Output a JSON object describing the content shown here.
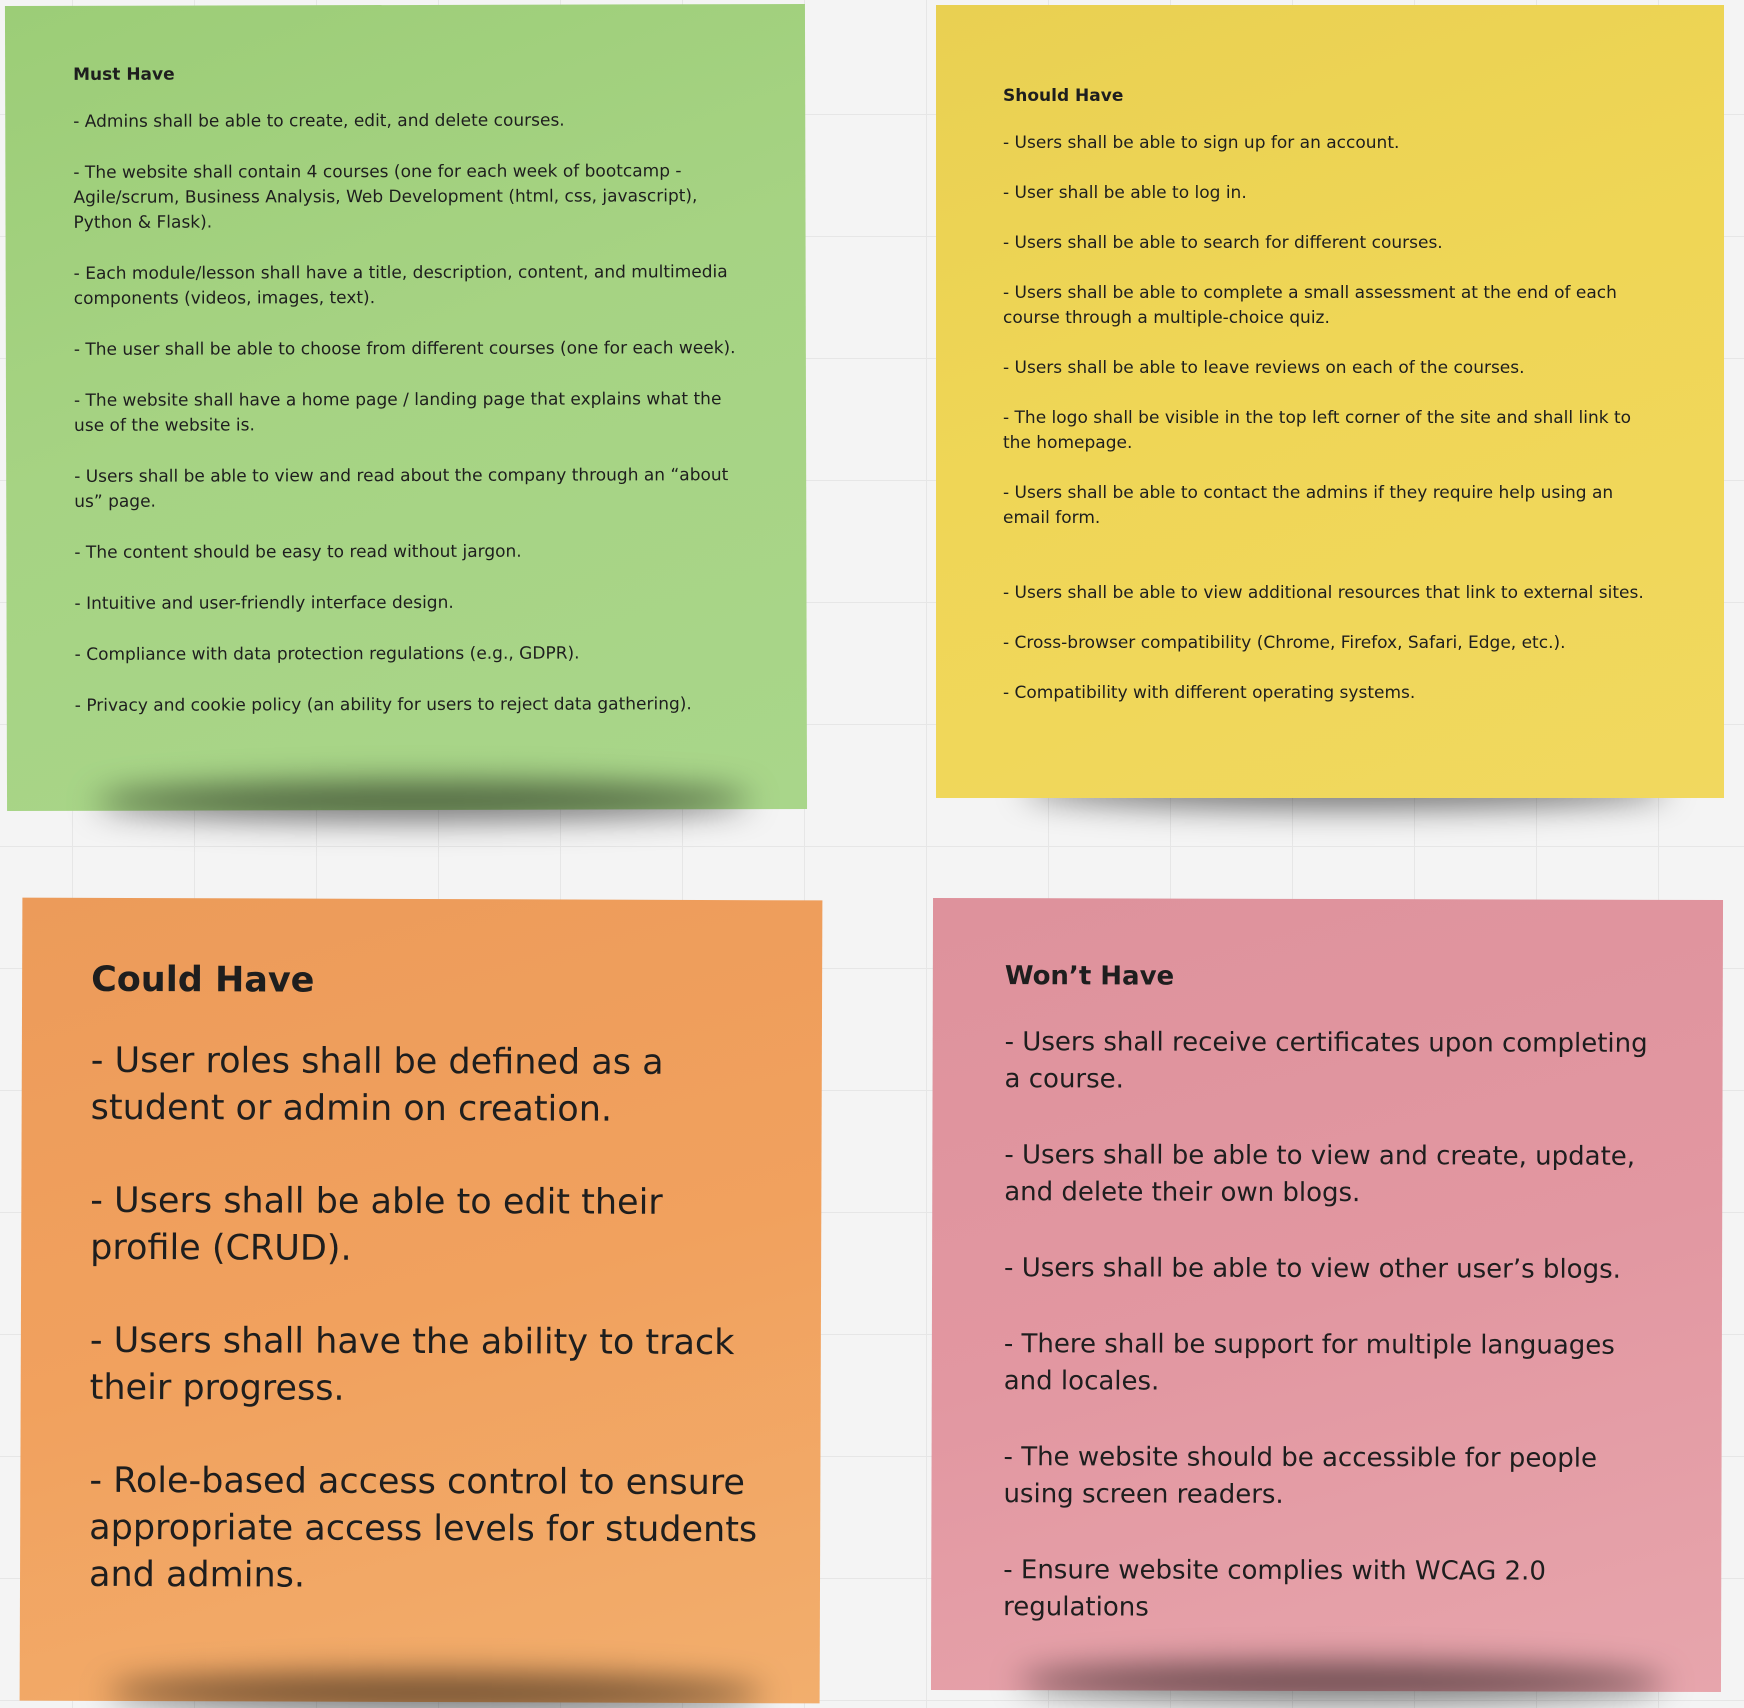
{
  "notes": {
    "must": {
      "title": "Must Have",
      "color": "#a6d383",
      "items": [
        "- Admins shall be able to create, edit, and delete courses.",
        "- The website shall contain 4 courses (one for each week of bootcamp - Agile/scrum, Business Analysis, Web Development (html, css, javascript), Python & Flask).",
        "- Each module/lesson shall have a title, description, content, and multimedia components (videos, images, text).",
        "- The user shall be able to choose from different courses (one for each week).",
        "- The website shall have a home page / landing page that explains what the use of the website is.",
        "- Users shall be able to view and read about the company through an “about us” page.",
        "- The content should be easy to read without jargon.",
        "- Intuitive and user-friendly interface design.",
        "- Compliance with data protection regulations (e.g., GDPR).",
        "- Privacy and cookie policy (an ability for users to reject data gathering)."
      ]
    },
    "should": {
      "title": "Should Have",
      "color": "#efd656",
      "items": [
        "- Users shall be able to sign up for an account.",
        "- User shall be able to log in.",
        "- Users shall be able to search for different courses.",
        "- Users shall be able to complete a small assessment at the end of each course through a multiple-choice quiz.",
        "- Users shall be able to leave reviews on each of the courses.",
        "- The logo shall be visible in the top left corner of the site and shall link to the homepage.",
        "- Users shall be able to contact the admins if they require help using an email form.",
        "- Users shall be able to view additional resources that link to external sites.",
        "- Cross-browser compatibility (Chrome, Firefox, Safari, Edge, etc.).",
        "- Compatibility with different operating systems."
      ]
    },
    "could": {
      "title": "Could Have",
      "color": "#f1a15e",
      "items": [
        "- User roles shall be defined as a student or admin on creation.",
        "- Users shall be able to edit their profile (CRUD).",
        "- Users shall have the ability to track their progress.",
        "- Role-based access control to ensure appropriate access levels for students and admins."
      ]
    },
    "wont": {
      "title": "Won’t Have",
      "color": "#e297a1",
      "items": [
        "- Users shall receive certificates upon completing a course.",
        "- Users shall be able to view and create, update, and delete their own blogs.",
        "- Users shall be able to view other user’s blogs.",
        "- There shall be support for multiple languages and locales.",
        "- The website should be accessible for people using screen readers.",
        "- Ensure website complies with WCAG 2.0 regulations"
      ]
    }
  }
}
